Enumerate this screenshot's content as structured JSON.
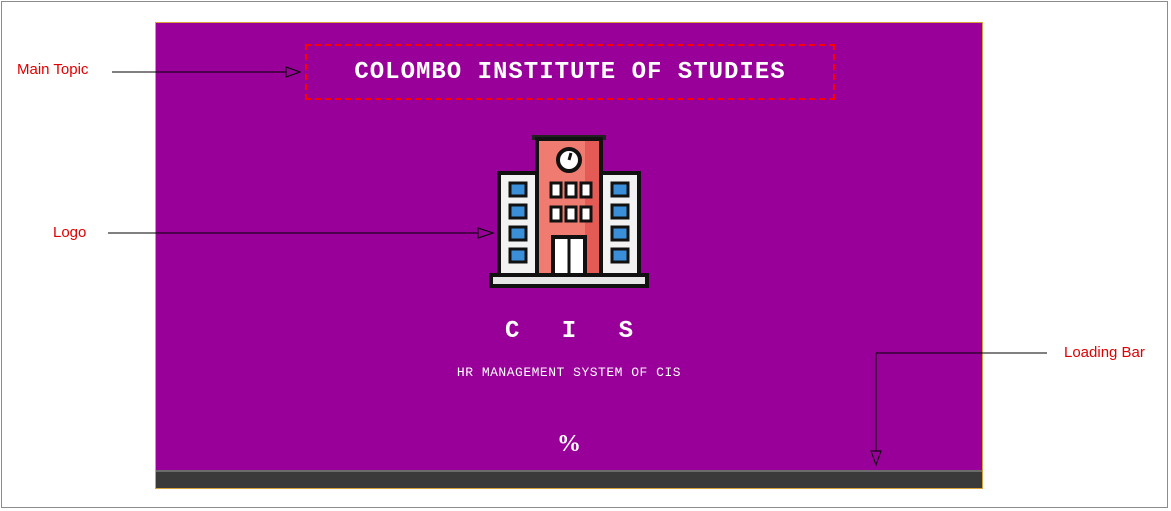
{
  "splash": {
    "title": "COLOMBO INSTITUTE OF STUDIES",
    "short_name": "C I S",
    "subtitle": "HR MANAGEMENT SYSTEM OF CIS",
    "percent_text": "%",
    "progress": 0
  },
  "annotations": {
    "main_topic": "Main Topic",
    "logo": "Logo",
    "loading_bar": "Loading Bar"
  },
  "colors": {
    "background": "#990099",
    "annotation": "#e00000",
    "title_border": "#ff0000",
    "loading_track": "#3a3a3a"
  },
  "icons": {
    "logo": "school-building-icon"
  }
}
